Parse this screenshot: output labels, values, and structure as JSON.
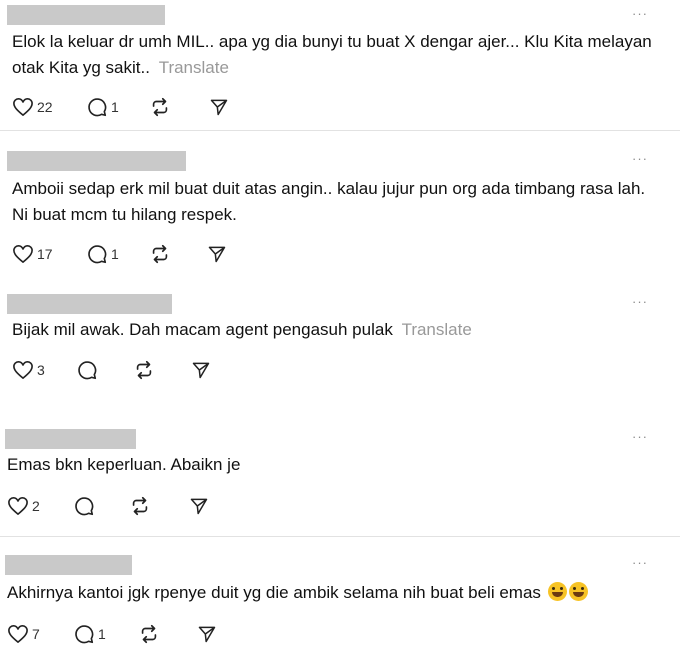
{
  "posts": [
    {
      "text": "Elok la keluar dr umh MIL.. apa yg dia bunyi tu buat X dengar ajer... Klu Kita melayan otak Kita yg sakit..",
      "translate": "Translate",
      "likes": "22",
      "replies": "1",
      "more": "···"
    },
    {
      "text": "Amboii sedap erk mil buat duit atas angin.. kalau jujur pun org ada timbang rasa lah. Ni buat mcm tu hilang respek.",
      "translate": "",
      "likes": "17",
      "replies": "1",
      "more": "···"
    },
    {
      "text": "Bijak mil awak. Dah macam agent pengasuh pulak",
      "translate": "Translate",
      "likes": "3",
      "replies": "",
      "more": "···"
    },
    {
      "text": "Emas bkn keperluan. Abaikn je",
      "translate": "",
      "likes": "2",
      "replies": "",
      "more": "···"
    },
    {
      "text": "Akhirnya kantoi jgk rpenye duit yg die ambik selama nih buat beli emas",
      "translate": "",
      "likes": "7",
      "replies": "1",
      "more": "···"
    }
  ],
  "icons": {
    "like": "heart-icon",
    "reply": "comment-icon",
    "repost": "repost-icon",
    "share": "send-icon",
    "emoji": "grinning-sweat-emoji, laughing-tears-emoji"
  },
  "colors": {
    "text": "#111111",
    "muted": "#999999",
    "redaction": "#c9c9c9",
    "divider": "#e2e2e2"
  }
}
